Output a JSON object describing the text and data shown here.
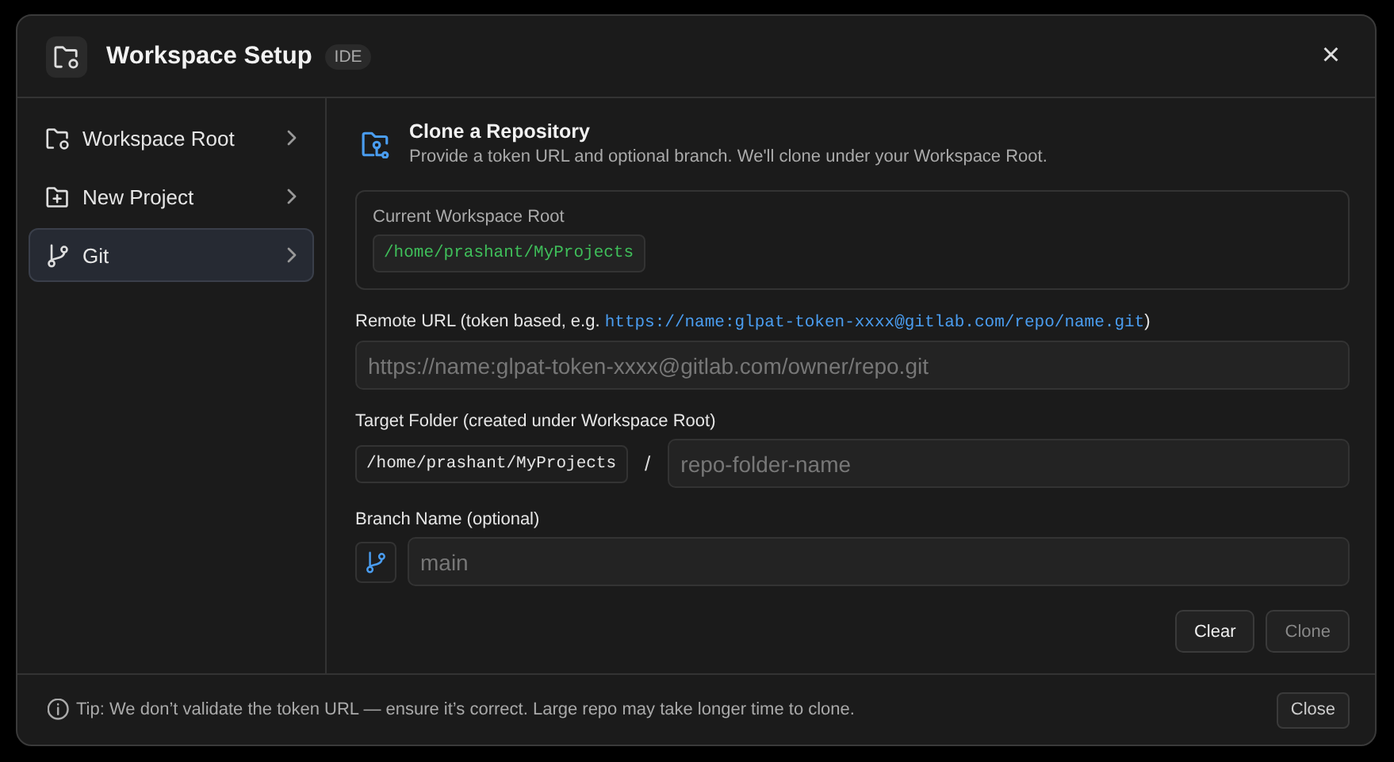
{
  "window": {
    "title": "Workspace Setup",
    "badge": "IDE",
    "close_label": "×"
  },
  "sidebar": {
    "items": [
      {
        "label": "Workspace Root",
        "selected": false
      },
      {
        "label": "New Project",
        "selected": false
      },
      {
        "label": "Git",
        "selected": true
      }
    ]
  },
  "content": {
    "title": "Clone a Repository",
    "subtitle": "Provide a token URL and optional branch. We'll clone under your Workspace Root.",
    "workspace_root": {
      "label": "Current Workspace Root",
      "path": "/home/prashant/MyProjects"
    },
    "remote_url": {
      "label_prefix": "Remote URL (token based, e.g. ",
      "example": "https://name:glpat-token-xxxx@gitlab.com/repo/name.git",
      "label_suffix": ")",
      "placeholder": "https://name:glpat-token-xxxx@gitlab.com/owner/repo.git"
    },
    "target_folder": {
      "label": "Target Folder (created under Workspace Root)",
      "prefix": "/home/prashant/MyProjects",
      "separator": "/",
      "placeholder": "repo-folder-name"
    },
    "branch": {
      "label": "Branch Name (optional)",
      "placeholder": "main"
    },
    "buttons": [
      {
        "label": "Clear",
        "disabled": false
      },
      {
        "label": "Clone",
        "disabled": true
      }
    ]
  },
  "footer": {
    "tip": "Tip: We don’t validate the token URL — ensure it’s correct. Large repo may take longer time to clone.",
    "button": "Close"
  }
}
